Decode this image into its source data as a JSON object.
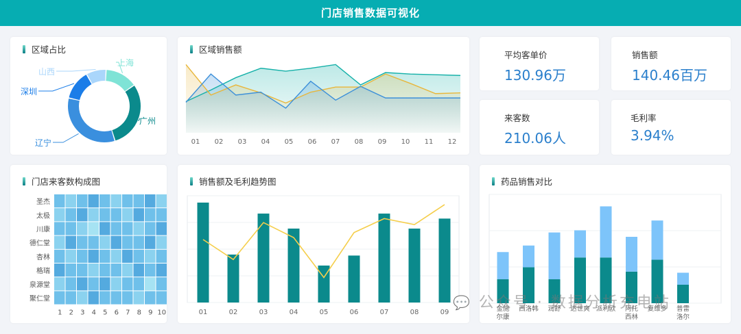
{
  "header": {
    "title": "门店销售数据可视化"
  },
  "region_share": {
    "title": "区域占比",
    "chart_data": {
      "type": "pie",
      "slices": [
        {
          "label": "上海",
          "value": 13,
          "color": "#7fe3d6"
        },
        {
          "label": "广州",
          "value": 27,
          "color": "#0b8a8c"
        },
        {
          "label": "辽宁",
          "value": 30,
          "color": "#3a8fde"
        },
        {
          "label": "深圳",
          "value": 12,
          "color": "#1b7de8"
        },
        {
          "label": "山西",
          "value": 8,
          "color": "#aad6fb"
        }
      ]
    }
  },
  "region_sales": {
    "title": "区域销售额",
    "chart_data": {
      "type": "area",
      "categories": [
        "01",
        "02",
        "03",
        "04",
        "05",
        "06",
        "07",
        "08",
        "09",
        "10",
        "11",
        "12"
      ],
      "ylim": [
        0,
        100
      ],
      "series": [
        {
          "values": [
            43,
            59,
            76,
            89,
            85,
            89,
            94,
            66,
            83,
            81,
            80,
            79
          ],
          "color": "#14b0a8"
        },
        {
          "values": [
            94,
            52,
            66,
            55,
            41,
            56,
            63,
            63,
            81,
            68,
            54,
            55
          ],
          "color": "#e8b63a"
        },
        {
          "values": [
            42,
            81,
            52,
            56,
            34,
            71,
            45,
            64,
            48,
            48,
            48,
            48
          ],
          "color": "#3b8fd9"
        }
      ]
    }
  },
  "kpis": [
    {
      "label": "平均客单价",
      "value": "130.96万"
    },
    {
      "label": "销售额",
      "value": "140.46百万"
    },
    {
      "label": "来客数",
      "value": "210.06人"
    },
    {
      "label": "毛利率",
      "value": "3.94%"
    }
  ],
  "store_traffic": {
    "title": "门店来客数构成图",
    "chart_data": {
      "type": "heatmap",
      "rows": [
        "圣杰",
        "太极",
        "川康",
        "德仁堂",
        "杏林",
        "格瑞",
        "泉源堂",
        "聚仁堂"
      ],
      "cols": [
        "1",
        "2",
        "3",
        "4",
        "5",
        "6",
        "7",
        "8",
        "9",
        "10"
      ],
      "values": [
        [
          3,
          2,
          3,
          4,
          3,
          2,
          3,
          3,
          4,
          2
        ],
        [
          2,
          3,
          4,
          2,
          3,
          3,
          2,
          4,
          3,
          3
        ],
        [
          3,
          3,
          2,
          1,
          4,
          3,
          3,
          2,
          3,
          4
        ],
        [
          2,
          4,
          3,
          3,
          2,
          4,
          3,
          3,
          4,
          2
        ],
        [
          3,
          2,
          3,
          4,
          3,
          2,
          4,
          3,
          2,
          3
        ],
        [
          4,
          3,
          3,
          2,
          3,
          3,
          2,
          4,
          3,
          4
        ],
        [
          2,
          3,
          4,
          3,
          4,
          2,
          3,
          3,
          1,
          3
        ],
        [
          3,
          3,
          2,
          4,
          3,
          3,
          3,
          2,
          3,
          3
        ]
      ]
    }
  },
  "sales_trend": {
    "title": "销售额及毛利趋势图",
    "chart_data": {
      "type": "bar",
      "categories": [
        "01",
        "02",
        "03",
        "04",
        "05",
        "06",
        "07",
        "08",
        "09"
      ],
      "ylim": [
        0,
        100
      ],
      "series": [
        {
          "values": [
            100,
            48,
            89,
            74,
            37,
            47,
            89,
            74,
            84
          ],
          "color": "#0b8a8c"
        },
        {
          "values": [
            63,
            43,
            80,
            65,
            25,
            70,
            84,
            78,
            98
          ],
          "color": "#f5ce4a"
        }
      ]
    }
  },
  "drug_sales": {
    "title": "药品销售对比",
    "chart_data": {
      "type": "bar",
      "categories": [
        "金施尔康",
        "西洛韩",
        "润舒",
        "达世爽",
        "派利欧",
        "阿托西林",
        "复维多",
        "普雷洛尔"
      ],
      "ylim": [
        0,
        100
      ],
      "series": [
        {
          "values": [
            22,
            33,
            22,
            42,
            42,
            29,
            40,
            17
          ],
          "color": "#0b8a8c"
        },
        {
          "values": [
            25,
            20,
            43,
            25,
            47,
            32,
            36,
            11
          ],
          "color": "#7dc4fa"
        }
      ]
    }
  },
  "watermark": {
    "text": "公众号 · 数据分析充电站"
  }
}
